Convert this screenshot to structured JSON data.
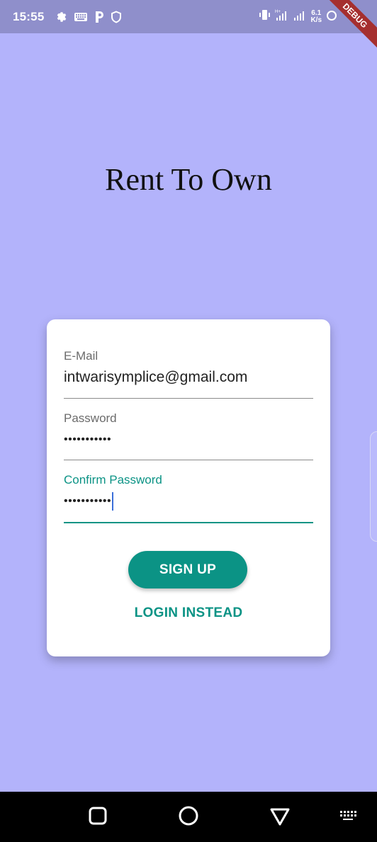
{
  "status_bar": {
    "time": "15:55",
    "net_speed_value": "6.1",
    "net_speed_unit": "K/s",
    "debug_label": "DEBUG"
  },
  "app": {
    "title": "Rent To Own"
  },
  "form": {
    "email": {
      "label": "E-Mail",
      "value": "intwarisymplice@gmail.com"
    },
    "password": {
      "label": "Password",
      "value": "•••••••••••"
    },
    "confirm_password": {
      "label": "Confirm Password",
      "value": "•••••••••••"
    },
    "signup_label": "SIGN UP",
    "login_label": "LOGIN INSTEAD"
  },
  "colors": {
    "background": "#b3b3fb",
    "status_bar": "#8f8fcb",
    "accent": "#0b9385",
    "card": "#ffffff"
  },
  "icons": {
    "status": [
      "gear-icon",
      "keyboard-icon",
      "p-app-icon",
      "shield-icon",
      "vibrate-icon",
      "signal-icon",
      "signal-icon-2",
      "alarm-icon"
    ],
    "navigation": [
      "square-recents-icon",
      "circle-home-icon",
      "triangle-back-icon",
      "keyboard-nav-icon"
    ]
  }
}
